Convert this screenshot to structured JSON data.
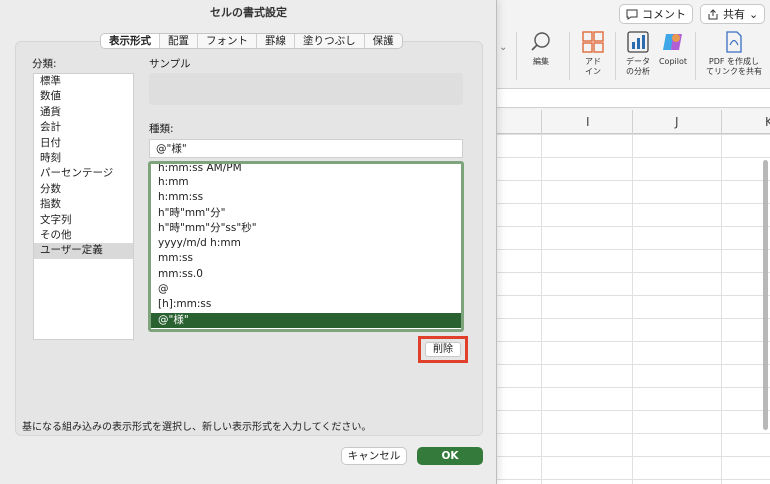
{
  "dialog": {
    "title": "セルの書式設定",
    "tabs": [
      "表示形式",
      "配置",
      "フォント",
      "罫線",
      "塗りつぶし",
      "保護"
    ],
    "active_tab": "表示形式",
    "category_label": "分類:",
    "categories": [
      "標準",
      "数値",
      "通貨",
      "会計",
      "日付",
      "時刻",
      "パーセンテージ",
      "分数",
      "指数",
      "文字列",
      "その他",
      "ユーザー定義"
    ],
    "selected_category": "ユーザー定義",
    "sample_label": "サンプル",
    "sample_value": "",
    "type_label": "種類:",
    "type_value": "@\"様\"",
    "formats": [
      "h:mm:ss AM/PM",
      "h:mm",
      "h:mm:ss",
      "h\"時\"mm\"分\"",
      "h\"時\"mm\"分\"ss\"秒\"",
      "yyyy/m/d h:mm",
      "mm:ss",
      "mm:ss.0",
      "@",
      "[h]:mm:ss",
      "@\"様\""
    ],
    "selected_format": "@\"様\"",
    "delete_label": "削除",
    "description": "基になる組み込みの表示形式を選択し、新しい表示形式を入力してください。",
    "cancel_label": "キャンセル",
    "ok_label": "OK",
    "accent_color": "#347a3b",
    "highlight_color": "#e0402a"
  },
  "excel": {
    "comment_label": "コメント",
    "share_label": "共有",
    "ribbon": {
      "edit_label": "編集",
      "addin_label": "アド\nイン",
      "data_analysis_label": "データ\nの分析",
      "copilot_label": "Copilot",
      "pdf_label": "PDF を作成し\nてリンクを共有"
    },
    "columns": [
      "I",
      "J",
      "K"
    ]
  }
}
